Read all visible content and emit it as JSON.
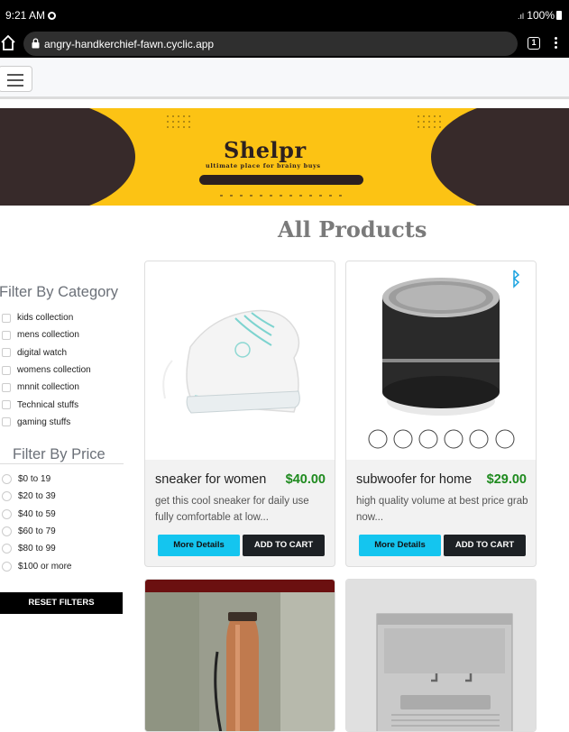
{
  "status_bar": {
    "time": "9:21 AM",
    "battery": "100%"
  },
  "browser": {
    "url": "angry-handkerchief-fawn.cyclic.app",
    "tab_count": "1"
  },
  "banner": {
    "brand": "Shelpr",
    "tagline": "ultimate place for brainy buys"
  },
  "page_title": "All Products",
  "sidebar": {
    "category_title": "Filter By Category",
    "categories": [
      "kids collection",
      "mens collection",
      "digital watch",
      "womens collection",
      "mnnit collection",
      "Technical stuffs",
      "gaming stuffs"
    ],
    "price_title": "Filter By Price",
    "prices": [
      "$0 to 19",
      "$20 to 39",
      "$40 to 59",
      "$60 to 79",
      "$80 to 99",
      "$100 or more"
    ],
    "reset_label": "RESET FILTERS"
  },
  "products": [
    {
      "name": "sneaker for women",
      "price": "$40.00",
      "description": "get this cool sneaker for daily use fully comfortable at low...",
      "details_label": "More Details",
      "cart_label": "ADD TO CART"
    },
    {
      "name": "subwoofer for home",
      "price": "$29.00",
      "description": "high quality volume at best price grab now...",
      "details_label": "More Details",
      "cart_label": "ADD TO CART"
    }
  ],
  "colors": {
    "banner_yellow": "#fcc314",
    "banner_dark": "#372a2a",
    "price_green": "#1e8a1e",
    "details_cyan": "#14c5ef",
    "cart_dark": "#1d2125"
  }
}
